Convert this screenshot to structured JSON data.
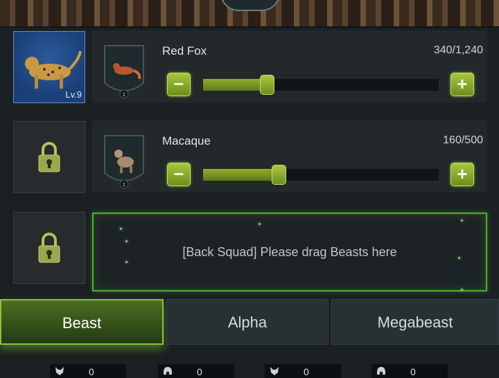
{
  "squads": [
    {
      "slot": {
        "level": "Lv.9",
        "locked": false
      },
      "unit_name": "Red Fox",
      "count": "340/1,240",
      "slider_fraction": 0.27,
      "badge_number": "1"
    },
    {
      "slot": {
        "locked": true
      },
      "unit_name": "Macaque",
      "count": "160/500",
      "slider_fraction": 0.32,
      "badge_number": "1"
    }
  ],
  "drop_zone": {
    "text": "[Back Squad] Please drag Beasts here"
  },
  "tabs": [
    {
      "label": "Beast",
      "active": true
    },
    {
      "label": "Alpha",
      "active": false
    },
    {
      "label": "Megabeast",
      "active": false
    }
  ],
  "stats": [
    {
      "icon": "wolf-icon",
      "value": "0"
    },
    {
      "icon": "helmet-icon",
      "value": "0"
    },
    {
      "icon": "wolf-icon",
      "value": "0"
    },
    {
      "icon": "helmet-icon",
      "value": "0"
    }
  ],
  "colors": {
    "accent_green": "#8bc33a",
    "slot_blue": "#2d5b9c"
  }
}
